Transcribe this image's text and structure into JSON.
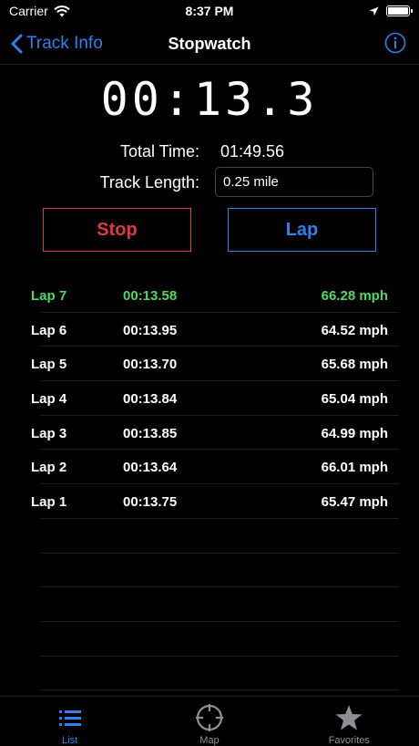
{
  "status": {
    "carrier": "Carrier",
    "time": "8:37 PM"
  },
  "nav": {
    "back_label": "Track Info",
    "title": "Stopwatch"
  },
  "timer": {
    "display": "00:13.3"
  },
  "summary": {
    "total_label": "Total Time:",
    "total_value": "01:49.56",
    "track_label": "Track Length:",
    "track_value": "0.25 mile"
  },
  "buttons": {
    "stop_label": "Stop",
    "lap_label": "Lap"
  },
  "laps": [
    {
      "name": "Lap 7",
      "time": "00:13.58",
      "speed": "66.28 mph",
      "current": true
    },
    {
      "name": "Lap 6",
      "time": "00:13.95",
      "speed": "64.52 mph"
    },
    {
      "name": "Lap 5",
      "time": "00:13.70",
      "speed": "65.68 mph"
    },
    {
      "name": "Lap 4",
      "time": "00:13.84",
      "speed": "65.04 mph"
    },
    {
      "name": "Lap 3",
      "time": "00:13.85",
      "speed": "64.99 mph"
    },
    {
      "name": "Lap 2",
      "time": "00:13.64",
      "speed": "66.01 mph"
    },
    {
      "name": "Lap 1",
      "time": "00:13.75",
      "speed": "65.47 mph"
    }
  ],
  "tabs": [
    {
      "label": "List",
      "icon": "list-icon",
      "active": true
    },
    {
      "label": "Map",
      "icon": "crosshair-icon"
    },
    {
      "label": "Favorites",
      "icon": "star-icon"
    }
  ],
  "colors": {
    "accent": "#2f80ed",
    "stop": "#e0393e",
    "current_lap": "#4cd964",
    "inactive_tab": "#8e8e93"
  }
}
